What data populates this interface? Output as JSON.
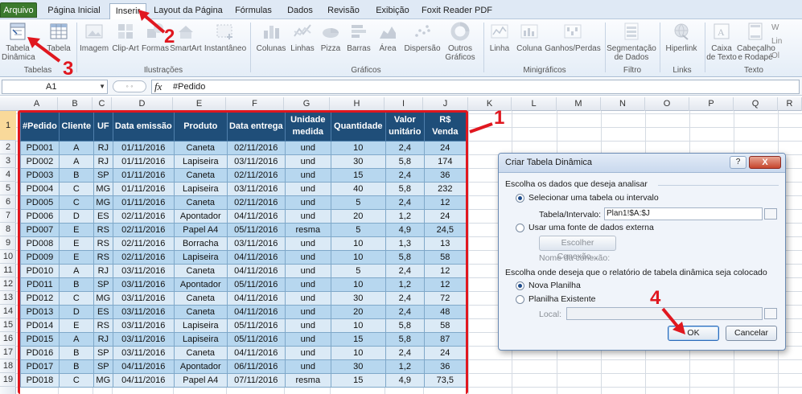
{
  "tabs": {
    "file": "Arquivo",
    "home": "Página Inicial",
    "insert": "Inserir",
    "page_layout": "Layout da Página",
    "formulas": "Fórmulas",
    "data": "Dados",
    "review": "Revisão",
    "view": "Exibição",
    "foxit": "Foxit Reader PDF"
  },
  "ribbon": {
    "pivot_line1": "Tabela",
    "pivot_line2": "Dinâmica",
    "table": "Tabela",
    "image": "Imagem",
    "clipart": "Clip-Art",
    "shapes": "Formas",
    "smartart": "SmartArt",
    "screenshot": "Instantâneo",
    "columns": "Colunas",
    "lines": "Linhas",
    "pie": "Pizza",
    "bars": "Barras",
    "area": "Área",
    "scatter": "Dispersão",
    "other_line1": "Outros",
    "other_line2": "Gráficos",
    "spark_line": "Linha",
    "spark_column": "Coluna",
    "spark_winloss": "Ganhos/Perdas",
    "slicer_line1": "Segmentação",
    "slicer_line2": "de Dados",
    "hyperlink": "Hiperlink",
    "textbox_line1": "Caixa",
    "textbox_line2": "de Texto",
    "header_line1": "Cabeçalho",
    "header_line2": "e Rodapé",
    "group_tables": "Tabelas",
    "group_illustrations": "Ilustrações",
    "group_charts": "Gráficos",
    "group_sparklines": "Minigráficos",
    "group_filter": "Filtro",
    "group_links": "Links",
    "group_text": "Texto",
    "extra_w": "W",
    "extra_lin": "Lin",
    "extra_ol": "Ol"
  },
  "formula_bar": {
    "name_box": "A1",
    "fx": "fx",
    "content": "#Pedido"
  },
  "columns": [
    "A",
    "B",
    "C",
    "D",
    "E",
    "F",
    "G",
    "H",
    "I",
    "J",
    "K",
    "L",
    "M",
    "N",
    "O",
    "P",
    "Q",
    "R"
  ],
  "rows": [
    "1",
    "2",
    "3",
    "4",
    "5",
    "6",
    "7",
    "8",
    "9",
    "10",
    "11",
    "12",
    "13",
    "14",
    "15",
    "16",
    "17",
    "18",
    "19"
  ],
  "table": {
    "headers": [
      "#Pedido",
      "Cliente",
      "UF",
      "Data emissão",
      "Produto",
      "Data entrega",
      "Unidade medida",
      "Quantidade",
      "Valor unitário",
      "R$ Venda"
    ],
    "rows": [
      [
        "PD001",
        "A",
        "RJ",
        "01/11/2016",
        "Caneta",
        "02/11/2016",
        "und",
        "10",
        "2,4",
        "24"
      ],
      [
        "PD002",
        "A",
        "RJ",
        "01/11/2016",
        "Lapiseira",
        "03/11/2016",
        "und",
        "30",
        "5,8",
        "174"
      ],
      [
        "PD003",
        "B",
        "SP",
        "01/11/2016",
        "Caneta",
        "02/11/2016",
        "und",
        "15",
        "2,4",
        "36"
      ],
      [
        "PD004",
        "C",
        "MG",
        "01/11/2016",
        "Lapiseira",
        "03/11/2016",
        "und",
        "40",
        "5,8",
        "232"
      ],
      [
        "PD005",
        "C",
        "MG",
        "01/11/2016",
        "Caneta",
        "02/11/2016",
        "und",
        "5",
        "2,4",
        "12"
      ],
      [
        "PD006",
        "D",
        "ES",
        "02/11/2016",
        "Apontador",
        "04/11/2016",
        "und",
        "20",
        "1,2",
        "24"
      ],
      [
        "PD007",
        "E",
        "RS",
        "02/11/2016",
        "Papel A4",
        "05/11/2016",
        "resma",
        "5",
        "4,9",
        "24,5"
      ],
      [
        "PD008",
        "E",
        "RS",
        "02/11/2016",
        "Borracha",
        "03/11/2016",
        "und",
        "10",
        "1,3",
        "13"
      ],
      [
        "PD009",
        "E",
        "RS",
        "02/11/2016",
        "Lapiseira",
        "04/11/2016",
        "und",
        "10",
        "5,8",
        "58"
      ],
      [
        "PD010",
        "A",
        "RJ",
        "03/11/2016",
        "Caneta",
        "04/11/2016",
        "und",
        "5",
        "2,4",
        "12"
      ],
      [
        "PD011",
        "B",
        "SP",
        "03/11/2016",
        "Apontador",
        "05/11/2016",
        "und",
        "10",
        "1,2",
        "12"
      ],
      [
        "PD012",
        "C",
        "MG",
        "03/11/2016",
        "Caneta",
        "04/11/2016",
        "und",
        "30",
        "2,4",
        "72"
      ],
      [
        "PD013",
        "D",
        "ES",
        "03/11/2016",
        "Caneta",
        "04/11/2016",
        "und",
        "20",
        "2,4",
        "48"
      ],
      [
        "PD014",
        "E",
        "RS",
        "03/11/2016",
        "Lapiseira",
        "05/11/2016",
        "und",
        "10",
        "5,8",
        "58"
      ],
      [
        "PD015",
        "A",
        "RJ",
        "03/11/2016",
        "Lapiseira",
        "05/11/2016",
        "und",
        "15",
        "5,8",
        "87"
      ],
      [
        "PD016",
        "B",
        "SP",
        "03/11/2016",
        "Caneta",
        "04/11/2016",
        "und",
        "10",
        "2,4",
        "24"
      ],
      [
        "PD017",
        "B",
        "SP",
        "04/11/2016",
        "Apontador",
        "06/11/2016",
        "und",
        "30",
        "1,2",
        "36"
      ],
      [
        "PD018",
        "C",
        "MG",
        "04/11/2016",
        "Papel A4",
        "07/11/2016",
        "resma",
        "15",
        "4,9",
        "73,5"
      ]
    ]
  },
  "dialog": {
    "title": "Criar Tabela Dinâmica",
    "help": "?",
    "close": "X",
    "section1": "Escolha os dados que deseja analisar",
    "opt_select_table": "Selecionar uma tabela ou intervalo",
    "range_label": "Tabela/Intervalo:",
    "range_value": "Plan1!$A:$J",
    "opt_external": "Usar uma fonte de dados externa",
    "choose_connection": "Escolher Conexão...",
    "connection_name": "Nome da conexão:",
    "section2": "Escolha onde deseja que o relatório de tabela dinâmica seja colocado",
    "opt_new_sheet": "Nova Planilha",
    "opt_existing_sheet": "Planilha Existente",
    "location_label": "Local:",
    "ok": "OK",
    "cancel": "Cancelar"
  },
  "annotations": [
    "1",
    "2",
    "3",
    "4"
  ],
  "colors": {
    "annotation_red": "#e0171f",
    "header_navy": "#1f4e79",
    "row_blue": "#b7d7ef",
    "row_light": "#dbeaf6",
    "file_tab_green": "#3c7a2e"
  }
}
